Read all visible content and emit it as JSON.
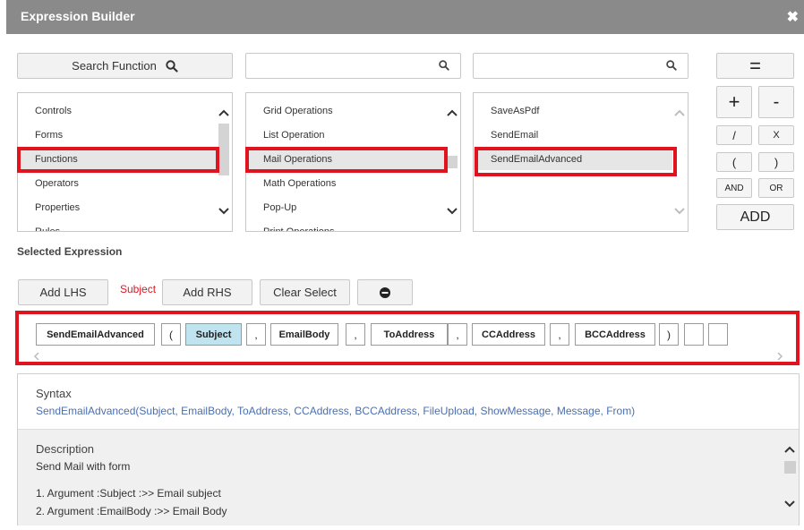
{
  "dialog": {
    "title": "Expression Builder",
    "close_glyph": "✖"
  },
  "search_function_label": "Search Function",
  "search1": {
    "value": "",
    "placeholder": ""
  },
  "search2": {
    "value": "",
    "placeholder": ""
  },
  "lists": {
    "categories": {
      "items": [
        "Controls",
        "Forms",
        "Functions",
        "Operators",
        "Properties",
        "Rules"
      ],
      "selected": "Functions"
    },
    "functions": {
      "items": [
        "Grid Operations",
        "List Operation",
        "Mail Operations",
        "Math Operations",
        "Pop-Up",
        "Print Operations"
      ],
      "selected": "Mail Operations"
    },
    "operations": {
      "items": [
        "SaveAsPdf",
        "SendEmail",
        "SendEmailAdvanced"
      ],
      "selected": "SendEmailAdvanced"
    }
  },
  "operators": {
    "equals": "=",
    "plus": "+",
    "minus": "-",
    "divide": "/",
    "multiply": "X",
    "open_paren": "(",
    "close_paren": ")",
    "and": "AND",
    "or": "OR",
    "add": "ADD"
  },
  "selected_expression_label": "Selected Expression",
  "actions": {
    "add_lhs": "Add LHS",
    "subject": "Subject",
    "add_rhs": "Add RHS",
    "clear_select": "Clear Select"
  },
  "expression_tokens": [
    "SendEmailAdvanced",
    "(",
    "Subject",
    ",",
    "EmailBody",
    ",",
    "ToAddress",
    ",",
    "CCAddress",
    ",",
    "BCCAddress",
    ")",
    "",
    ""
  ],
  "info": {
    "syntax_label": "Syntax",
    "syntax_text": "SendEmailAdvanced(Subject, EmailBody, ToAddress, CCAddress, BCCAddress, FileUpload, ShowMessage, Message, From)",
    "description_label": "Description",
    "description_text": "Send Mail with form",
    "arguments": [
      "1. Argument :Subject :>> Email subject",
      "2. Argument :EmailBody :>> Email Body"
    ]
  },
  "colors": {
    "highlight": "#e0141e",
    "titlebar": "#8a8a8a",
    "link": "#4a6fb1",
    "active_token": "#bfe3ef"
  }
}
